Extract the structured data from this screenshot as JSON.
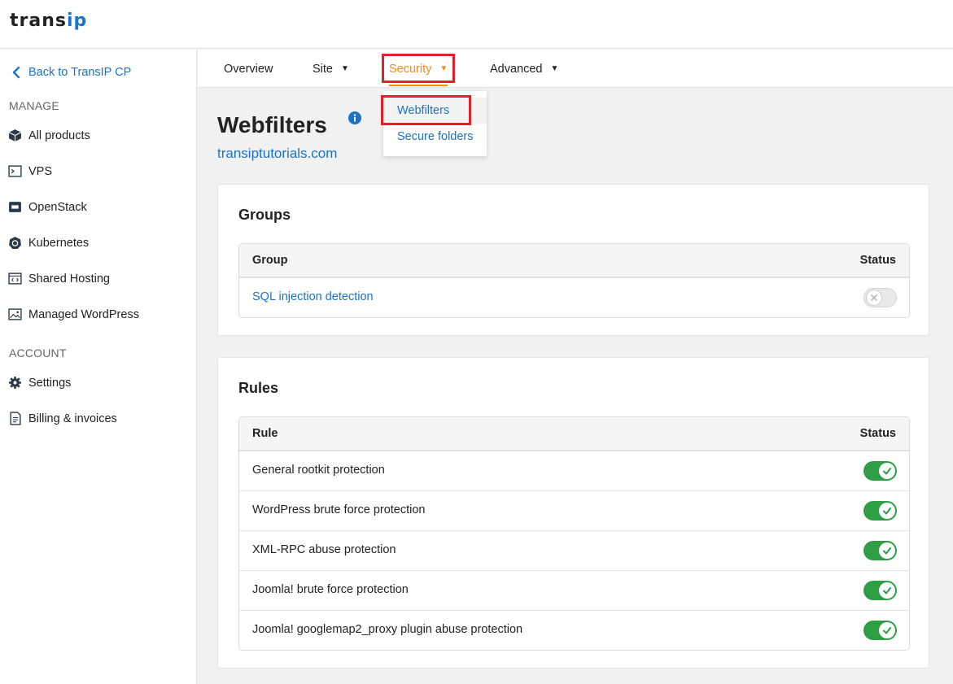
{
  "app": {
    "logo_main": "trans",
    "logo_accent": "ip",
    "accent_color": "#1a73c7",
    "active_color": "#f28c1e",
    "toggle_on_color": "#2e9e45"
  },
  "sidebar": {
    "back_label": "Back to TransIP CP",
    "manage_label": "MANAGE",
    "account_label": "ACCOUNT",
    "manage_items": [
      {
        "label": "All products",
        "icon": "cube-icon"
      },
      {
        "label": "VPS",
        "icon": "terminal-icon"
      },
      {
        "label": "OpenStack",
        "icon": "openstack-icon"
      },
      {
        "label": "Kubernetes",
        "icon": "kubernetes-icon"
      },
      {
        "label": "Shared Hosting",
        "icon": "code-window-icon"
      },
      {
        "label": "Managed WordPress",
        "icon": "image-icon"
      }
    ],
    "account_items": [
      {
        "label": "Settings",
        "icon": "gear-icon"
      },
      {
        "label": "Billing & invoices",
        "icon": "invoice-icon"
      }
    ]
  },
  "subnav": {
    "tabs": [
      {
        "label": "Overview",
        "has_caret": false
      },
      {
        "label": "Site",
        "has_caret": true
      },
      {
        "label": "Security",
        "has_caret": true,
        "active": true
      },
      {
        "label": "Advanced",
        "has_caret": true
      }
    ],
    "caret": "▼"
  },
  "dropdown": {
    "items": [
      "Webfilters",
      "Secure folders"
    ]
  },
  "page": {
    "title": "Webfilters",
    "domain": "transiptutorials.com"
  },
  "groups": {
    "heading": "Groups",
    "col_name": "Group",
    "col_status": "Status",
    "rows": [
      {
        "name": "SQL injection detection",
        "enabled": false
      }
    ]
  },
  "rules": {
    "heading": "Rules",
    "col_name": "Rule",
    "col_status": "Status",
    "rows": [
      {
        "name": "General rootkit protection",
        "enabled": true
      },
      {
        "name": "WordPress brute force protection",
        "enabled": true
      },
      {
        "name": "XML-RPC abuse protection",
        "enabled": true
      },
      {
        "name": "Joomla! brute force protection",
        "enabled": true
      },
      {
        "name": "Joomla! googlemap2_proxy plugin abuse protection",
        "enabled": true
      }
    ]
  }
}
